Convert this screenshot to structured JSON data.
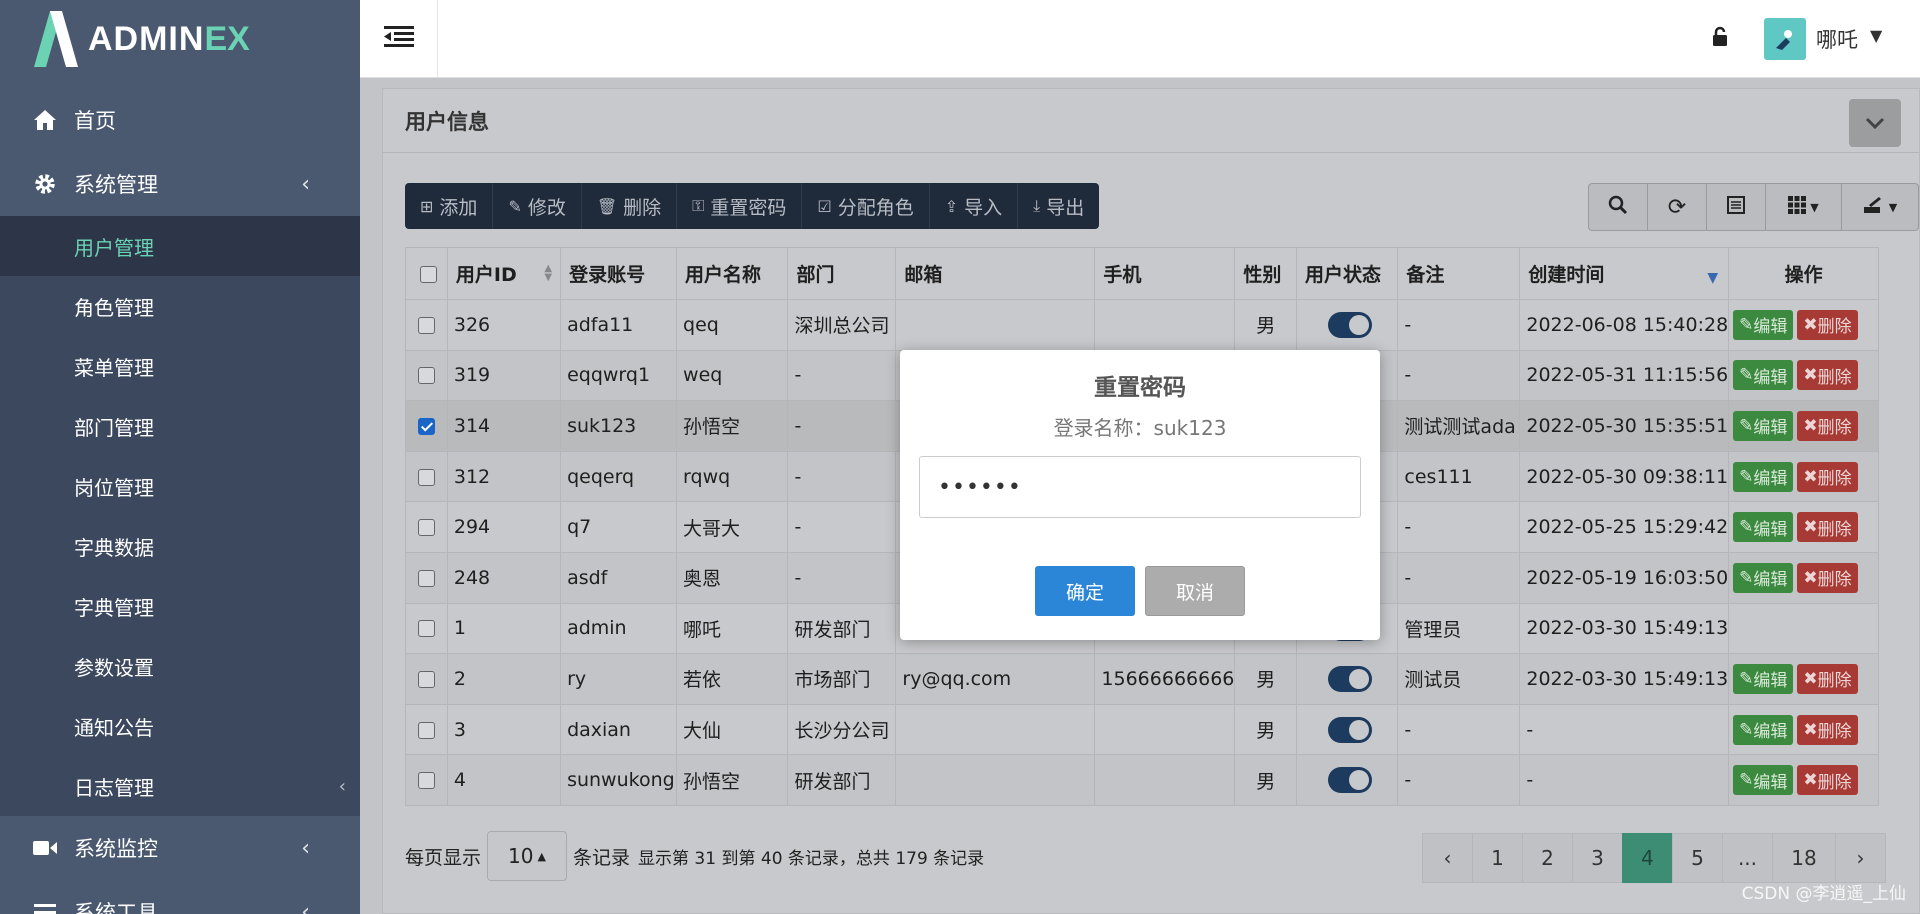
{
  "brand": {
    "part1": "ADMIN",
    "part2": "EX"
  },
  "sidebar": {
    "home": "首页",
    "system": "系统管理",
    "sub": [
      "用户管理",
      "角色管理",
      "菜单管理",
      "部门管理",
      "岗位管理",
      "字典数据",
      "字典管理",
      "参数设置",
      "通知公告",
      "日志管理"
    ],
    "monitor": "系统监控",
    "tools": "系统工具"
  },
  "header": {
    "username": "哪吒"
  },
  "panel": {
    "title": "用户信息"
  },
  "toolbar": {
    "add": "添加",
    "edit": "修改",
    "delete": "删除",
    "reset": "重置密码",
    "assign": "分配角色",
    "import": "导入",
    "export": "导出"
  },
  "table": {
    "headers": [
      "用户ID",
      "登录账号",
      "用户名称",
      "部门",
      "邮箱",
      "手机",
      "性别",
      "用户状态",
      "备注",
      "创建时间",
      "操作"
    ],
    "rows": [
      {
        "id": "326",
        "login": "adfa11",
        "name": "qeq",
        "dept": "深圳总公司",
        "email": "",
        "phone": "",
        "gender": "男",
        "remark": "-",
        "created": "2022-06-08 15:40:28",
        "checked": false
      },
      {
        "id": "319",
        "login": "eqqwrq1",
        "name": "weq",
        "dept": "-",
        "email": "",
        "phone": "",
        "gender": "",
        "remark": "-",
        "created": "2022-05-31 11:15:56",
        "checked": false
      },
      {
        "id": "314",
        "login": "suk123",
        "name": "孙悟空",
        "dept": "-",
        "email": "",
        "phone": "",
        "gender": "",
        "remark": "测试测试ada",
        "created": "2022-05-30 15:35:51",
        "checked": true
      },
      {
        "id": "312",
        "login": "qeqerq",
        "name": "rqwq",
        "dept": "-",
        "email": "",
        "phone": "",
        "gender": "",
        "remark": "ces111",
        "created": "2022-05-30 09:38:11",
        "checked": false
      },
      {
        "id": "294",
        "login": "q7",
        "name": "大哥大",
        "dept": "-",
        "email": "",
        "phone": "",
        "gender": "",
        "remark": "-",
        "created": "2022-05-25 15:29:42",
        "checked": false
      },
      {
        "id": "248",
        "login": "asdf",
        "name": "奥恩",
        "dept": "-",
        "email": "",
        "phone": "",
        "gender": "",
        "remark": "-",
        "created": "2022-05-19 16:03:50",
        "checked": false
      },
      {
        "id": "1",
        "login": "admin",
        "name": "哪吒",
        "dept": "研发部门",
        "email": "",
        "phone": "",
        "gender": "",
        "remark": "管理员",
        "created": "2022-03-30 15:49:13",
        "checked": false
      },
      {
        "id": "2",
        "login": "ry",
        "name": "若依",
        "dept": "市场部门",
        "email": "ry@qq.com",
        "phone": "15666666666",
        "gender": "男",
        "remark": "测试员",
        "created": "2022-03-30 15:49:13",
        "checked": false
      },
      {
        "id": "3",
        "login": "daxian",
        "name": "大仙",
        "dept": "长沙分公司",
        "email": "",
        "phone": "",
        "gender": "男",
        "remark": "-",
        "created": "-",
        "checked": false
      },
      {
        "id": "4",
        "login": "sunwukong",
        "name": "孙悟空",
        "dept": "研发部门",
        "email": "",
        "phone": "",
        "gender": "男",
        "remark": "-",
        "created": "-",
        "checked": false
      }
    ],
    "edit_label": "编辑",
    "delete_label": "删除"
  },
  "footer": {
    "prefix": "每页显示",
    "page_size": "10",
    "suffix": "条记录",
    "summary": "显示第 31 到第 40 条记录，总共 179 条记录"
  },
  "pagination": {
    "prev": "‹",
    "pages": [
      "1",
      "2",
      "3",
      "4",
      "5",
      "...",
      "18"
    ],
    "current": "4",
    "next": "›"
  },
  "modal": {
    "title": "重置密码",
    "subtitle": "登录名称：suk123",
    "password_value": "••••••",
    "ok": "确定",
    "cancel": "取消"
  },
  "watermark": "CSDN @李逍遥_上仙"
}
